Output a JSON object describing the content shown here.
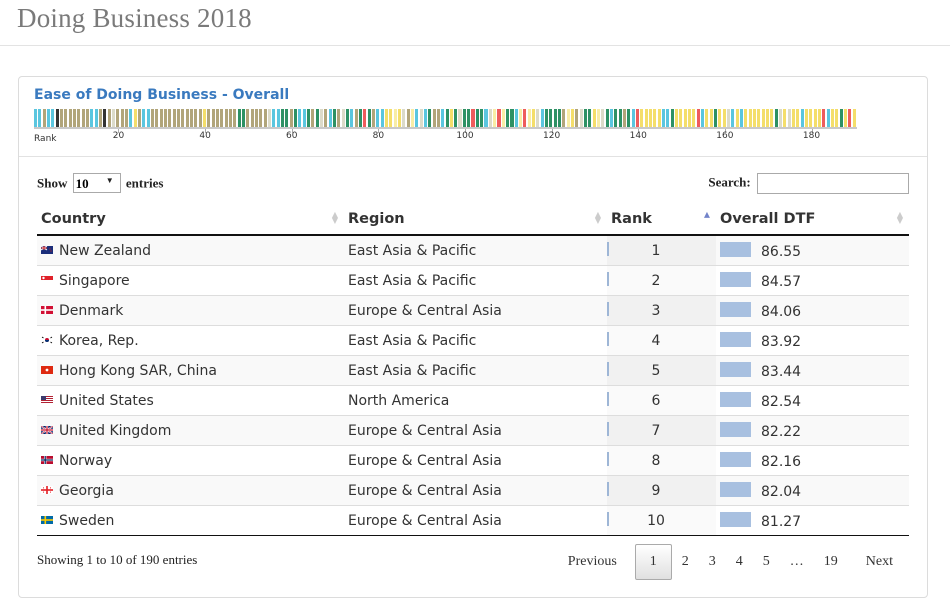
{
  "header": {
    "title": "Doing Business 2018"
  },
  "chart": {
    "title": "Ease of Doing Business - Overall",
    "rank_label": "Rank",
    "ticks": [
      "20",
      "40",
      "60",
      "80",
      "100",
      "120",
      "140",
      "160",
      "180"
    ],
    "total_ranks": 190,
    "palette": {
      "T": "#b1a57a",
      "C": "#5ac6df",
      "K": "#333333",
      "Y": "#f4de6a",
      "L": "#f8eda6",
      "G": "#2d9164",
      "W": "#dcdbc9",
      "R": "#ee5c5c"
    },
    "color_codes": "CCTCCKTTTTTTTCCTKTWTTTCYTCCTTTTTTTTTTTTYTTTTTTTGGTTTTTWCCGGTGCCGTGWTCGTWGCTGRGTCCYYLYWTLCWCGTTCGYGWGGRGGCWLRLGGCLRLYWCGGGGTLYTWGGYLWGCGGTGCRYYYYYCCGYYYYYRCYYGYYWCYCYYYYYYYGWYWYYCYYYYRCYYGYRYWWYGY"
  },
  "controls": {
    "show_label": "Show",
    "entries_label": "entries",
    "page_size": "10",
    "search_label": "Search:",
    "search_value": ""
  },
  "table": {
    "columns": [
      "Country",
      "Region",
      "Rank",
      "Overall DTF"
    ],
    "sorted_column": "Rank",
    "sort_direction": "ascending",
    "rows": [
      {
        "flag": "new-zealand-flag",
        "country": "New Zealand",
        "region": "East Asia & Pacific",
        "rank": "1",
        "dtf": "86.55"
      },
      {
        "flag": "singapore-flag",
        "country": "Singapore",
        "region": "East Asia & Pacific",
        "rank": "2",
        "dtf": "84.57"
      },
      {
        "flag": "denmark-flag",
        "country": "Denmark",
        "region": "Europe & Central Asia",
        "rank": "3",
        "dtf": "84.06"
      },
      {
        "flag": "korea-flag",
        "country": "Korea, Rep.",
        "region": "East Asia & Pacific",
        "rank": "4",
        "dtf": "83.92"
      },
      {
        "flag": "hong-kong-flag",
        "country": "Hong Kong SAR, China",
        "region": "East Asia & Pacific",
        "rank": "5",
        "dtf": "83.44"
      },
      {
        "flag": "united-states-flag",
        "country": "United States",
        "region": "North America",
        "rank": "6",
        "dtf": "82.54"
      },
      {
        "flag": "united-kingdom-flag",
        "country": "United Kingdom",
        "region": "Europe & Central Asia",
        "rank": "7",
        "dtf": "82.22"
      },
      {
        "flag": "norway-flag",
        "country": "Norway",
        "region": "Europe & Central Asia",
        "rank": "8",
        "dtf": "82.16"
      },
      {
        "flag": "georgia-flag",
        "country": "Georgia",
        "region": "Europe & Central Asia",
        "rank": "9",
        "dtf": "82.04"
      },
      {
        "flag": "sweden-flag",
        "country": "Sweden",
        "region": "Europe & Central Asia",
        "rank": "10",
        "dtf": "81.27"
      }
    ]
  },
  "footer": {
    "info": "Showing 1 to 10 of 190 entries",
    "pager": {
      "previous": "Previous",
      "pages": [
        "1",
        "2",
        "3",
        "4",
        "5",
        "…",
        "19"
      ],
      "current": "1",
      "next": "Next"
    }
  }
}
